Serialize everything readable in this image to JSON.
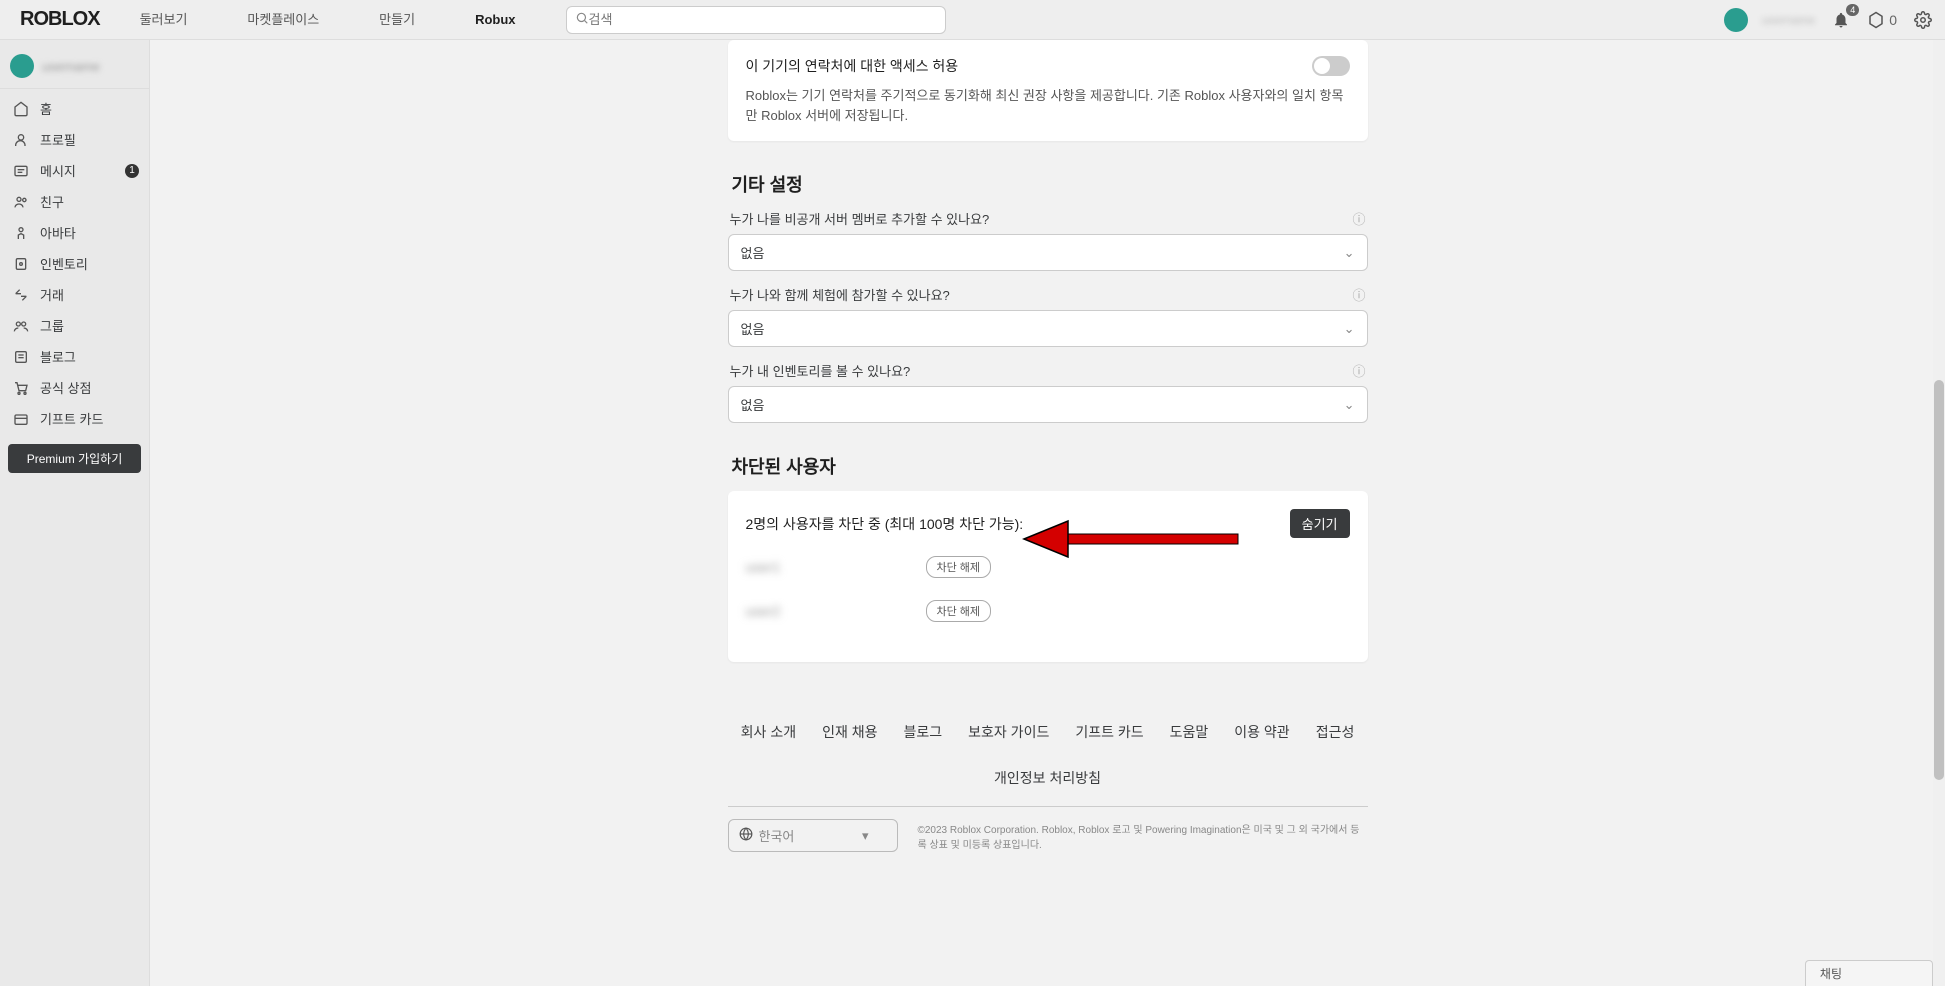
{
  "header": {
    "logo": "ROBLOX",
    "nav": [
      "둘러보기",
      "마켓플레이스",
      "만들기",
      "Robux"
    ],
    "search_placeholder": "검색",
    "notif_count": "4",
    "robux": "0"
  },
  "sidebar": {
    "username": "username",
    "items": [
      {
        "label": "홈",
        "icon": "home"
      },
      {
        "label": "프로필",
        "icon": "profile"
      },
      {
        "label": "메시지",
        "icon": "message",
        "badge": "1"
      },
      {
        "label": "친구",
        "icon": "friends"
      },
      {
        "label": "아바타",
        "icon": "avatar"
      },
      {
        "label": "인벤토리",
        "icon": "inventory"
      },
      {
        "label": "거래",
        "icon": "trade"
      },
      {
        "label": "그룹",
        "icon": "group"
      },
      {
        "label": "블로그",
        "icon": "blog"
      },
      {
        "label": "공식 상점",
        "icon": "shop"
      },
      {
        "label": "기프트 카드",
        "icon": "giftcard"
      }
    ],
    "premium": "Premium 가입하기"
  },
  "contact_access": {
    "title": "이 기기의 연락처에 대한 액세스 허용",
    "desc": "Roblox는 기기 연락처를 주기적으로 동기화해 최신 권장 사항을 제공합니다. 기존 Roblox 사용자와의 일치 항목만 Roblox 서버에 저장됩니다."
  },
  "other_settings": {
    "title": "기타 설정",
    "rows": [
      {
        "label": "누가 나를 비공개 서버 멤버로 추가할 수 있나요?",
        "value": "없음"
      },
      {
        "label": "누가 나와 함께 체험에 참가할 수 있나요?",
        "value": "없음"
      },
      {
        "label": "누가 내 인벤토리를 볼 수 있나요?",
        "value": "없음"
      }
    ]
  },
  "blocked": {
    "title": "차단된 사용자",
    "count_text": "2명의 사용자를 차단 중 (최대 100명 차단 가능):",
    "hide_label": "숨기기",
    "unblock_label": "차단 해제",
    "users": [
      "user1",
      "user2"
    ]
  },
  "footer": {
    "links": [
      "회사 소개",
      "인재 채용",
      "블로그",
      "보호자 가이드",
      "기프트 카드",
      "도움말",
      "이용 약관",
      "접근성",
      "개인정보 처리방침"
    ],
    "language": "한국어",
    "copyright": "©2023 Roblox Corporation. Roblox, Roblox 로고 및 Powering Imagination은 미국 및 그 외 국가에서 등록 상표 및 미등록 상표입니다."
  },
  "chat_label": "채팅"
}
